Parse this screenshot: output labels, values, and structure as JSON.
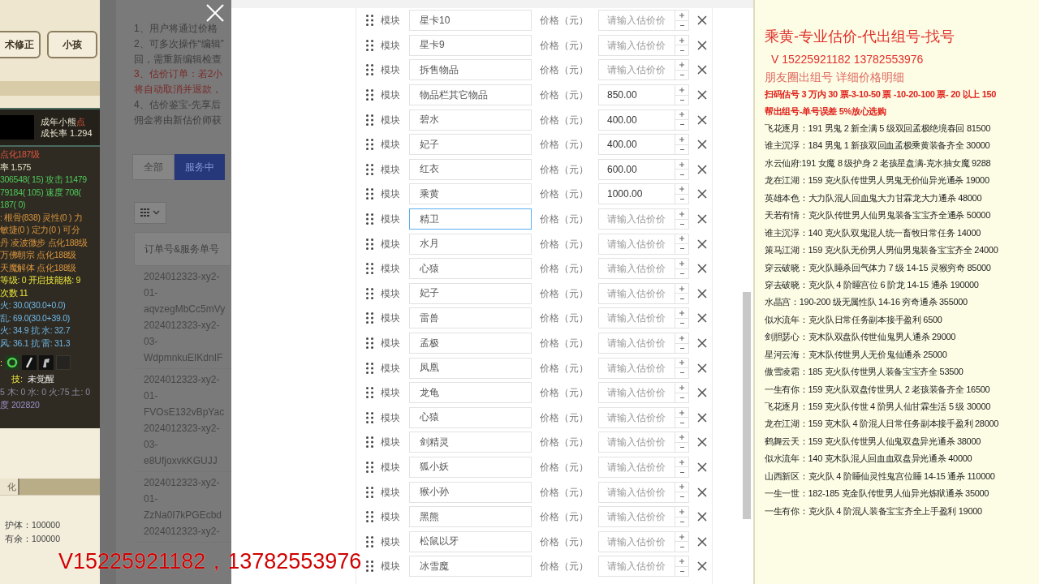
{
  "game_panel": {
    "tabs": [
      {
        "label": "术修正"
      },
      {
        "label": "小孩"
      }
    ],
    "pet_name": "成年小熊",
    "pet_tag": "点",
    "growth": "成长率 1.294",
    "stats": [
      {
        "text": "点化187级",
        "kind": "title"
      },
      {
        "text": "率 1.575",
        "kind": "base"
      },
      {
        "text": "306548( 15) 攻击 11479",
        "kind": "combat"
      },
      {
        "text": "79184( 105) 速度 708(",
        "kind": "combat"
      },
      {
        "text": "187( 0)",
        "kind": "combat"
      },
      {
        "text": ": 根骨(838) 灵性(0 ) 力",
        "kind": "aptitude"
      },
      {
        "text": "敏捷(0 ) 定力(0 ) 可分",
        "kind": "aptitude"
      },
      {
        "text": "丹 凌波微步 点化188级",
        "kind": "aptitude"
      },
      {
        "text": "万佛朝宗 点化188级",
        "kind": "aptitude"
      },
      {
        "text": "天魔解体 点化188级",
        "kind": "aptitude"
      },
      {
        "text": "等级: 0 开启技能格: 9",
        "kind": "level"
      },
      {
        "text": "次数 11",
        "kind": "level"
      },
      {
        "text": "火: 30.0(30.0+0.0)",
        "kind": "resist"
      },
      {
        "text": "乱: 69.0(30.0+39.0)",
        "kind": "resist"
      },
      {
        "text": "火: 34.9 抗  水: 32.7",
        "kind": "resist"
      },
      {
        "text": "风: 36.1 抗  雷: 31.3",
        "kind": "resist"
      }
    ],
    "icon_row_label": ":",
    "skill_label": "技:",
    "skill_value": "未觉醒",
    "element_line": "5 木: 0 水: 0 火:75 土: 0",
    "degree_line": "度 202820",
    "lower_tab": "化",
    "lower_stats": [
      "护体：100000",
      "有余：100000"
    ]
  },
  "middle_panel": {
    "notes": [
      {
        "text": "1、用户将通过价格",
        "kind": "plain"
      },
      {
        "text": "2、可多次操作“编辑”",
        "kind": "plain"
      },
      {
        "text": "回，需重新编辑检查",
        "kind": "plain"
      },
      {
        "text": "3、估价订单：若2小",
        "kind": "warning"
      },
      {
        "text": "将自动取消并退款，",
        "kind": "warning"
      },
      {
        "text": "4、估价鉴宝-先享后",
        "kind": "plain"
      },
      {
        "text": "佣金将由新估价师获",
        "kind": "plain"
      }
    ],
    "filters": [
      {
        "label": "全部",
        "selected": false
      },
      {
        "label": "服务中",
        "selected": true
      }
    ],
    "table_header": "订单号&服务单号",
    "orders": [
      [
        "2024012323-xy2-",
        "01-",
        "aqvzegMbCc5mVy",
        "2024012323-xy2-",
        "03-",
        "WdpmnkuEIKdnIF"
      ],
      [
        "2024012323-xy2-",
        "01-",
        "FVOsE132vBpYac",
        "2024012323-xy2-",
        "03-",
        "e8UfjoxvkKGUJJ"
      ],
      [
        "2024012323-xy2-",
        "01-",
        "ZzNa0I7kPGEcbd",
        "2024012323-xy2-"
      ]
    ]
  },
  "form_rows": [
    {
      "label": "模块",
      "name": "星卡10",
      "price_label": "价格（元）",
      "placeholder": "请输入估价价",
      "focused": false
    },
    {
      "label": "模块",
      "name": "星卡9",
      "price_label": "价格（元）",
      "placeholder": "请输入估价价",
      "focused": false
    },
    {
      "label": "模块",
      "name": "拆售物品",
      "price_label": "价格（元）",
      "placeholder": "请输入估价价",
      "focused": false
    },
    {
      "label": "模块",
      "name": "物品栏其它物品",
      "price_label": "价格（元）",
      "price": "850.00",
      "focused": false
    },
    {
      "label": "模块",
      "name": "碧水",
      "price_label": "价格（元）",
      "price": "400.00",
      "focused": false
    },
    {
      "label": "模块",
      "name": "妃子",
      "price_label": "价格（元）",
      "price": "400.00",
      "focused": false
    },
    {
      "label": "模块",
      "name": "红衣",
      "price_label": "价格（元）",
      "price": "600.00",
      "focused": false
    },
    {
      "label": "模块",
      "name": "乘黄",
      "price_label": "价格（元）",
      "price": "1000.00",
      "focused": false
    },
    {
      "label": "模块",
      "name": "精卫",
      "price_label": "价格（元）",
      "placeholder": "请输入估价价",
      "focused": true
    },
    {
      "label": "模块",
      "name": "水月",
      "price_label": "价格（元）",
      "placeholder": "请输入估价价",
      "focused": false
    },
    {
      "label": "模块",
      "name": "心猿",
      "price_label": "价格（元）",
      "placeholder": "请输入估价价",
      "focused": false
    },
    {
      "label": "模块",
      "name": "妃子",
      "price_label": "价格（元）",
      "placeholder": "请输入估价价",
      "focused": false
    },
    {
      "label": "模块",
      "name": "雷兽",
      "price_label": "价格（元）",
      "placeholder": "请输入估价价",
      "focused": false
    },
    {
      "label": "模块",
      "name": "孟极",
      "price_label": "价格（元）",
      "placeholder": "请输入估价价",
      "focused": false
    },
    {
      "label": "模块",
      "name": "凤凰",
      "price_label": "价格（元）",
      "placeholder": "请输入估价价",
      "focused": false
    },
    {
      "label": "模块",
      "name": "龙龟",
      "price_label": "价格（元）",
      "placeholder": "请输入估价价",
      "focused": false
    },
    {
      "label": "模块",
      "name": "心猿",
      "price_label": "价格（元）",
      "placeholder": "请输入估价价",
      "focused": false
    },
    {
      "label": "模块",
      "name": "剑精灵",
      "price_label": "价格（元）",
      "placeholder": "请输入估价价",
      "focused": false
    },
    {
      "label": "模块",
      "name": "狐小妖",
      "price_label": "价格（元）",
      "placeholder": "请输入估价价",
      "focused": false
    },
    {
      "label": "模块",
      "name": "猴小孙",
      "price_label": "价格（元）",
      "placeholder": "请输入估价价",
      "focused": false
    },
    {
      "label": "模块",
      "name": "黑熊",
      "price_label": "价格（元）",
      "placeholder": "请输入估价价",
      "focused": false
    },
    {
      "label": "模块",
      "name": "松鼠以牙",
      "price_label": "价格（元）",
      "placeholder": "请输入估价价",
      "focused": false
    },
    {
      "label": "模块",
      "name": "冰雪魔",
      "price_label": "价格（元）",
      "placeholder": "请输入估价价",
      "focused": false
    }
  ],
  "notes_panel": {
    "title": "乘黄-专业估价-代出组号-找号",
    "contact": "V 15225921182    13782553976",
    "subtitle": "朋友圈出组号    详细价格明细",
    "pricing": [
      "扫码估号 3 万内 30 票-3-10-50 票  -10-20-100 票- 20 以上 150",
      "帮出组号-单号误差 5%放心选购"
    ],
    "listings": [
      "飞花逐月：191 男鬼 2 新全满 5 级双回孟极绝境春回 81500",
      "谁主沉浮：184 男鬼 1 新孩双回血孟极乘黄装备齐全 30000",
      "水云仙府:191 女魔 8 级护身 2 老孩星盘满-克水抽女魔 9288",
      "龙在江湖：159 克火队传世男人男鬼无价仙异光通杀 19000",
      "英雄本色：大力队混人回血鬼大力甘霖龙大力通杀 48000",
      "天若有情：克火队传世男人仙男鬼装备宝宝齐全通杀 50000",
      "谁主沉浮：140 克火队双鬼混人统一畜牧日常任务 14000",
      "策马江湖：159 克火队无价男人男仙男鬼装备宝宝齐全 24000",
      "穿云破晓：克火队睡杀回气体力 7 级 14-15 灵猴穷奇 85000",
      "穿去破晓：克火队 4 阶睡宫位 6 阶龙 14-15 通杀 190000",
      "水晶宫：190-200 级无属性队 14-16 穷奇通杀 355000",
      "似水流年：克火队日常任务副本接手盈利 6500",
      "剑胆瑟心：克木队双盘队传世仙鬼男人通杀 29000",
      "星河云海：克木队传世男人无价鬼仙通杀 25000",
      "傲雪凌霜：185 克火队传世男人装备宝宝齐全 53500",
      "一生有你：159 克火队双盘传世男人 2 老孩装备齐全 16500",
      "飞花逐月：159 克火队传世 4 阶男人仙甘霖生活 5 级 30000",
      "龙在江湖：159 克木队 4 阶混人日常任务副本接手盈利 28000",
      "鹤舞云天：159 克火队传世男人仙鬼双盘异光通杀 38000",
      "似水流年：140 克木队混人回血血双盘异光通杀 40000",
      "山西新区：克火队 4 阶睡仙灵性鬼宫位睡 14-15 通杀 110000",
      "一生一世：182-185 克金队传世男人仙异光炼狱通杀 35000",
      "一生有你：克火队 4 阶混人装备宝宝齐全上手盈利 19000"
    ]
  },
  "overlay_caption": "V15225921182，13782553976"
}
